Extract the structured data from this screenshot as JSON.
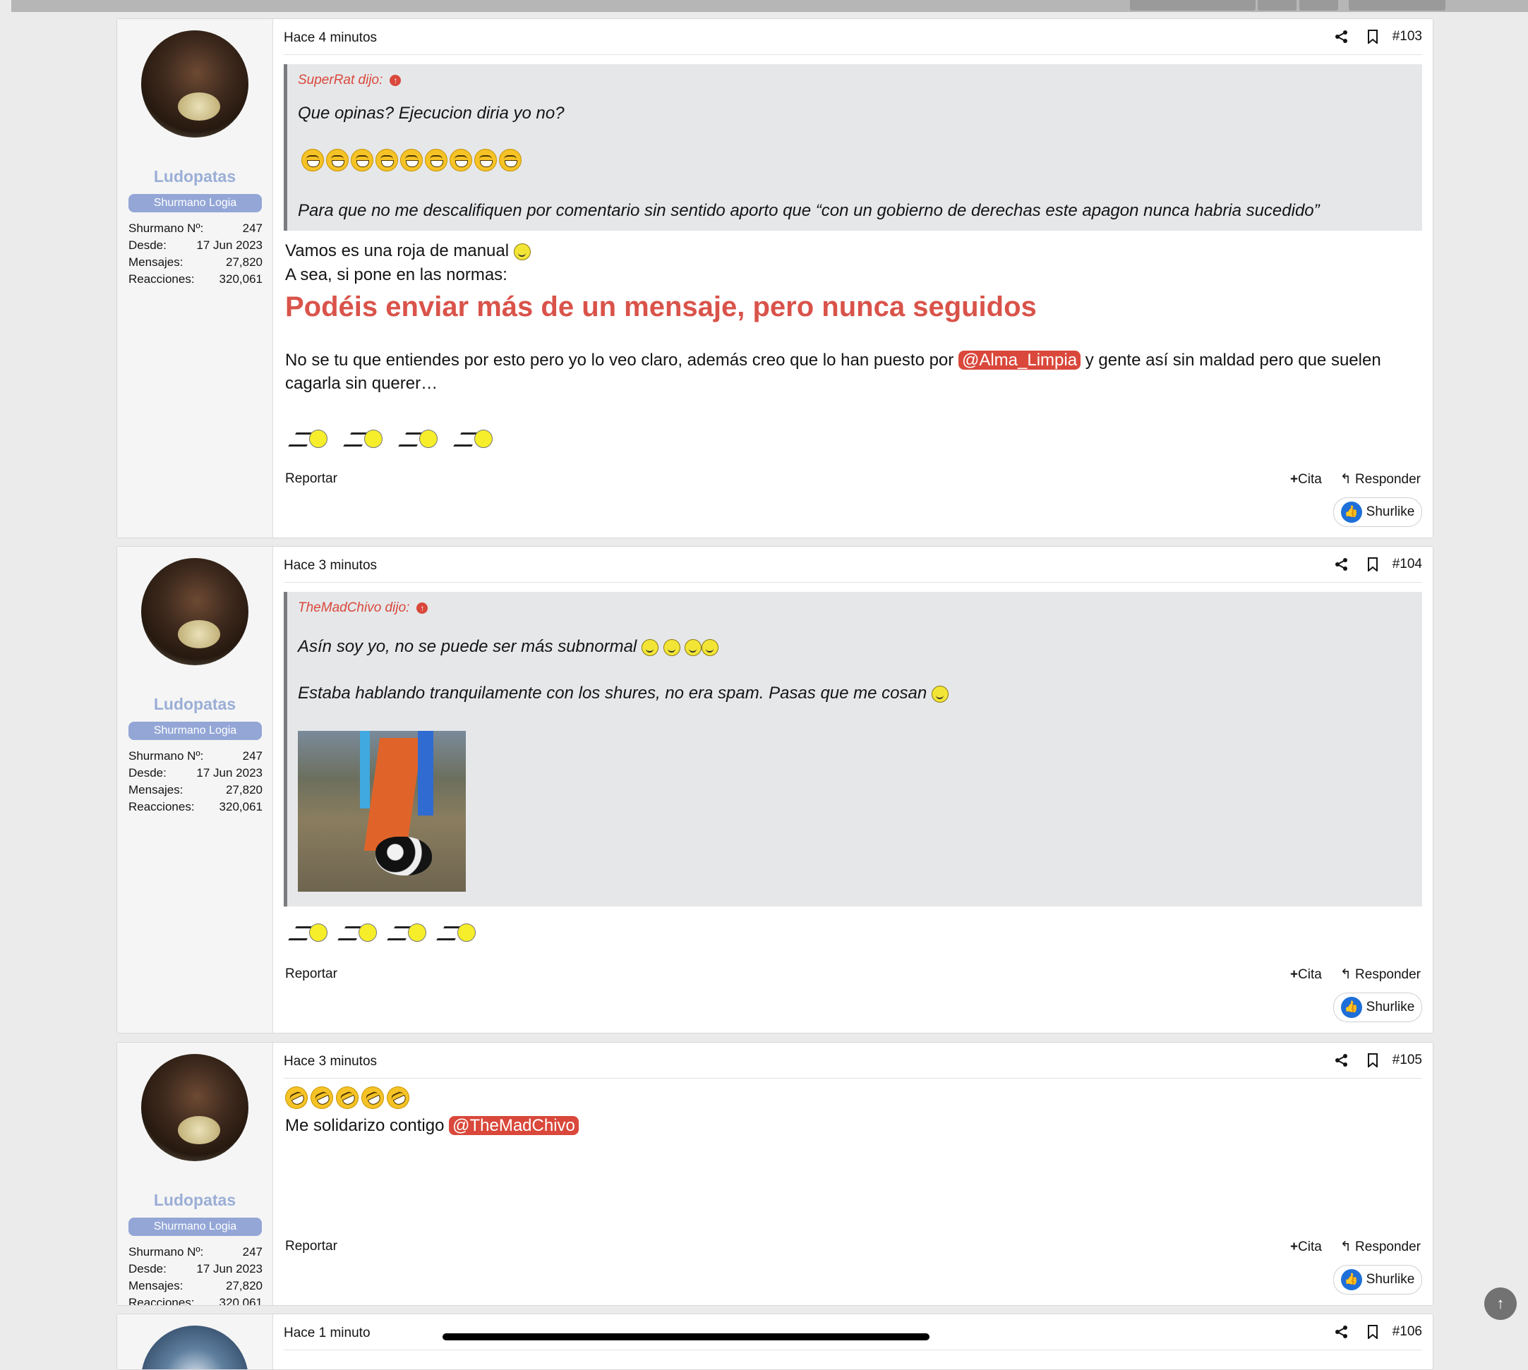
{
  "user": {
    "name": "Ludopatas",
    "role": "Shurmano Logia",
    "stats": [
      {
        "label": "Shurmano Nº:",
        "value": "247"
      },
      {
        "label": "Desde:",
        "value": "17 Jun 2023"
      },
      {
        "label": "Mensajes:",
        "value": "27,820"
      },
      {
        "label": "Reacciones:",
        "value": "320,061"
      }
    ]
  },
  "actions": {
    "report": "Reportar",
    "quote": "Cita",
    "reply": "Responder",
    "like": "Shurlike"
  },
  "posts": [
    {
      "time": "Hace 4 minutos",
      "number": "#103",
      "quote": {
        "author": "SuperRat dijo:",
        "line1": "Que opinas? Ejecucion diria yo no?",
        "line3": "Para que no me descalifiquen por comentario sin sentido aporto que “con un gobierno de derechas este apagon nunca habria sucedido”"
      },
      "body_line1": "Vamos es una roja de manual",
      "body_line2": "A sea, si pone en las normas:",
      "big_red": "Podéis enviar más de un mensaje, pero nunca seguidos",
      "body_para_before": "No se tu que entiendes por esto pero yo lo veo claro, además creo que lo han puesto por",
      "body_mention": "@Alma_Limpia",
      "body_para_after": "y gente así sin maldad pero que suelen cagarla sin querer…"
    },
    {
      "time": "Hace 3 minutos",
      "number": "#104",
      "quote": {
        "author": "TheMadChivo dijo:",
        "line1": "Asín soy yo, no se puede ser más subnormal",
        "line2": "Estaba hablando tranquilamente con los shures, no era spam. Pasas que me cosan"
      }
    },
    {
      "time": "Hace 3 minutos",
      "number": "#105",
      "body_text": "Me solidarizo contigo",
      "body_mention": "@TheMadChivo"
    },
    {
      "time": "Hace 1 minuto",
      "number": "#106"
    }
  ],
  "icons": [
    "share-icon",
    "bookmark-icon",
    "plus-icon",
    "reply-icon",
    "thumbs-up-icon",
    "arrow-up-icon"
  ],
  "colors": {
    "accent_red": "#d9483b",
    "username": "#9aaed6",
    "badge": "#93a6d6",
    "like_blue": "#1e6fd9"
  }
}
